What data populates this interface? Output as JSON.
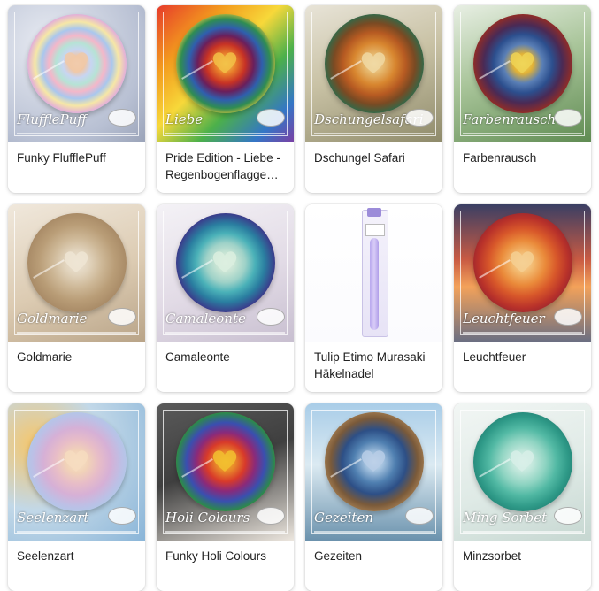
{
  "products": [
    {
      "title": "Funky FlufflePuff",
      "script": "FlufflePuff",
      "bg": "radial-gradient(circle at 30% 30%, #e9ecf3, #b8c0d3 70%, #9aa3b8)",
      "yarn": "radial-gradient(circle, #f7d8c4 0%, #f3c6a0 10%, #c8d5f2 20%, #b6e3d5 30%, #f4b7c9 40%, #a9c7ee 50%, #f6e7a6 60%, #e3b1d7 70%, #9ad6e3 80%, #c3b2ec 90%, #e0c8e6 100%)",
      "heart": "#f0c9a8"
    },
    {
      "title": "Pride Edition - Liebe - Regenbogenflagge Bobbel",
      "script": "Liebe",
      "bg": "linear-gradient(135deg, #e63a2b 0%, #f39c1e 25%, #f7d83a 45%, #4cb04a 65%, #3476c6 85%, #7b3fa4 100%)",
      "yarn": "radial-gradient(circle, #f3d25b 0%, #e77c2a 15%, #c73225 28%, #6a1f5c 40%, #2f5fae 52%, #2f8d52 64%, #f0c93a 76%, #e25a2a 88%, #3a2e7a 100%)",
      "heart": "#f2c046"
    },
    {
      "title": "Dschungel Safari",
      "script": "Dschungelsafari",
      "bg": "linear-gradient(160deg, #e8e4d8 0%, #c9c2a5 45%, #8e8a6a 100%)",
      "yarn": "radial-gradient(circle, #f2dfb0 0%, #e5b56a 15%, #d8862f 30%, #b65a22 45%, #7a4a23 58%, #2f6a4a 72%, #1e3f3e 86%, #12262d 100%)",
      "heart": "#f0d8a2"
    },
    {
      "title": "Farbenrausch",
      "script": "Farbenrausch",
      "bg": "linear-gradient(160deg, #e8efe4 0%, #a9c59a 45%, #5f8b52 100%)",
      "yarn": "radial-gradient(circle, #f1e26a 0%, #e2b236 14%, #5a7fb6 28%, #2c4f8e 42%, #4a2a55 56%, #8c2c2a 70%, #c7552a 84%, #2e2a2a 100%)",
      "heart": "#efd456"
    },
    {
      "title": "Goldmarie",
      "script": "Goldmarie",
      "bg": "linear-gradient(160deg, #f0e8dc 0%, #dccbb2 55%, #b9a488 100%)",
      "yarn": "radial-gradient(circle, #eee6d8 0%, #e1d3bc 18%, #cdb796 36%, #b99d77 54%, #a88a66 72%, #8f7658 88%, #7d6851 100%)",
      "heart": "#efe5d4"
    },
    {
      "title": "Camaleonte",
      "script": "Camaleonte",
      "bg": "linear-gradient(160deg, #f4f2f6 0%, #e2dbe6 55%, #c8bfd0 100%)",
      "yarn": "radial-gradient(circle, #e8efe4 0%, #c8e4d4 14%, #9fd2c8 28%, #4ab1b8 42%, #2a7ea0 56%, #3a3e8c 70%, #7a2a6a 84%, #a3204a 100%)",
      "heart": "#dbeedf"
    },
    {
      "title": "Tulip Etimo Murasaki Häkelnadel",
      "script": "",
      "bg": "linear-gradient(#ffffff, #fbfbfe)",
      "yarn": "",
      "heart": ""
    },
    {
      "title": "Leuchtfeuer",
      "script": "Leuchtfeuer",
      "bg": "linear-gradient(180deg, #3a3f64 0%, #c85a43 40%, #f3a25a 60%, #6b6f82 100%)",
      "yarn": "radial-gradient(circle, #f7d9a4 0%, #f2b76c 16%, #ea8a3a 32%, #d8582a 48%, #b9322a 64%, #8a2030 80%, #5a1e2a 100%)",
      "heart": "#f5cf92"
    },
    {
      "title": "Seelenzart",
      "script": "Seelenzart",
      "bg": "radial-gradient(circle at 20% 30%, #f6c66a, #c2d8e8 45%, #8ab5d8 100%)",
      "yarn": "radial-gradient(circle, #f8e4c6 0%, #f1d2b8 16%, #e7bcc8 32%, #d6b0d6 48%, #bcc0e6 64%, #a9cdea 80%, #9dbfe0 100%)",
      "heart": "#f6dcc0"
    },
    {
      "title": "Funky Holi Colours",
      "script": "Holi Colours",
      "bg": "linear-gradient(160deg, #5a5a5a 0%, #3f3f3f 45%, #ece6de 100%)",
      "yarn": "radial-gradient(circle, #f3c02a 0%, #e8872a 14%, #d83a2a 28%, #8a2a7a 42%, #3a4fb0 56%, #2c8a4a 70%, #f0d23a 84%, #e0462a 100%)",
      "heart": "#f2bf30"
    },
    {
      "title": "Gezeiten",
      "script": "Gezeiten",
      "bg": "linear-gradient(180deg, #a9cde8 0%, #dbeaf2 45%, #6b92ad 100%)",
      "yarn": "radial-gradient(circle, #dfe9f2 0%, #9fbedc 14%, #4f7fb0 30%, #2d4f86 46%, #7a5a3a 62%, #b38a5a 78%, #e8e2d6 100%)",
      "heart": "#b7cde6"
    },
    {
      "title": "Minzsorbet",
      "script": "Ming Sorbet",
      "bg": "linear-gradient(160deg, #f2f6f4 0%, #dfeae6 55%, #c6d7d1 100%)",
      "yarn": "radial-gradient(circle, #e6f3ee 0%, #bfe6da 16%, #8fd4c2 32%, #52b9a4 48%, #2f9a88 64%, #1f7a6e 80%, #1a5e58 100%)",
      "heart": "#d7efe7"
    }
  ]
}
